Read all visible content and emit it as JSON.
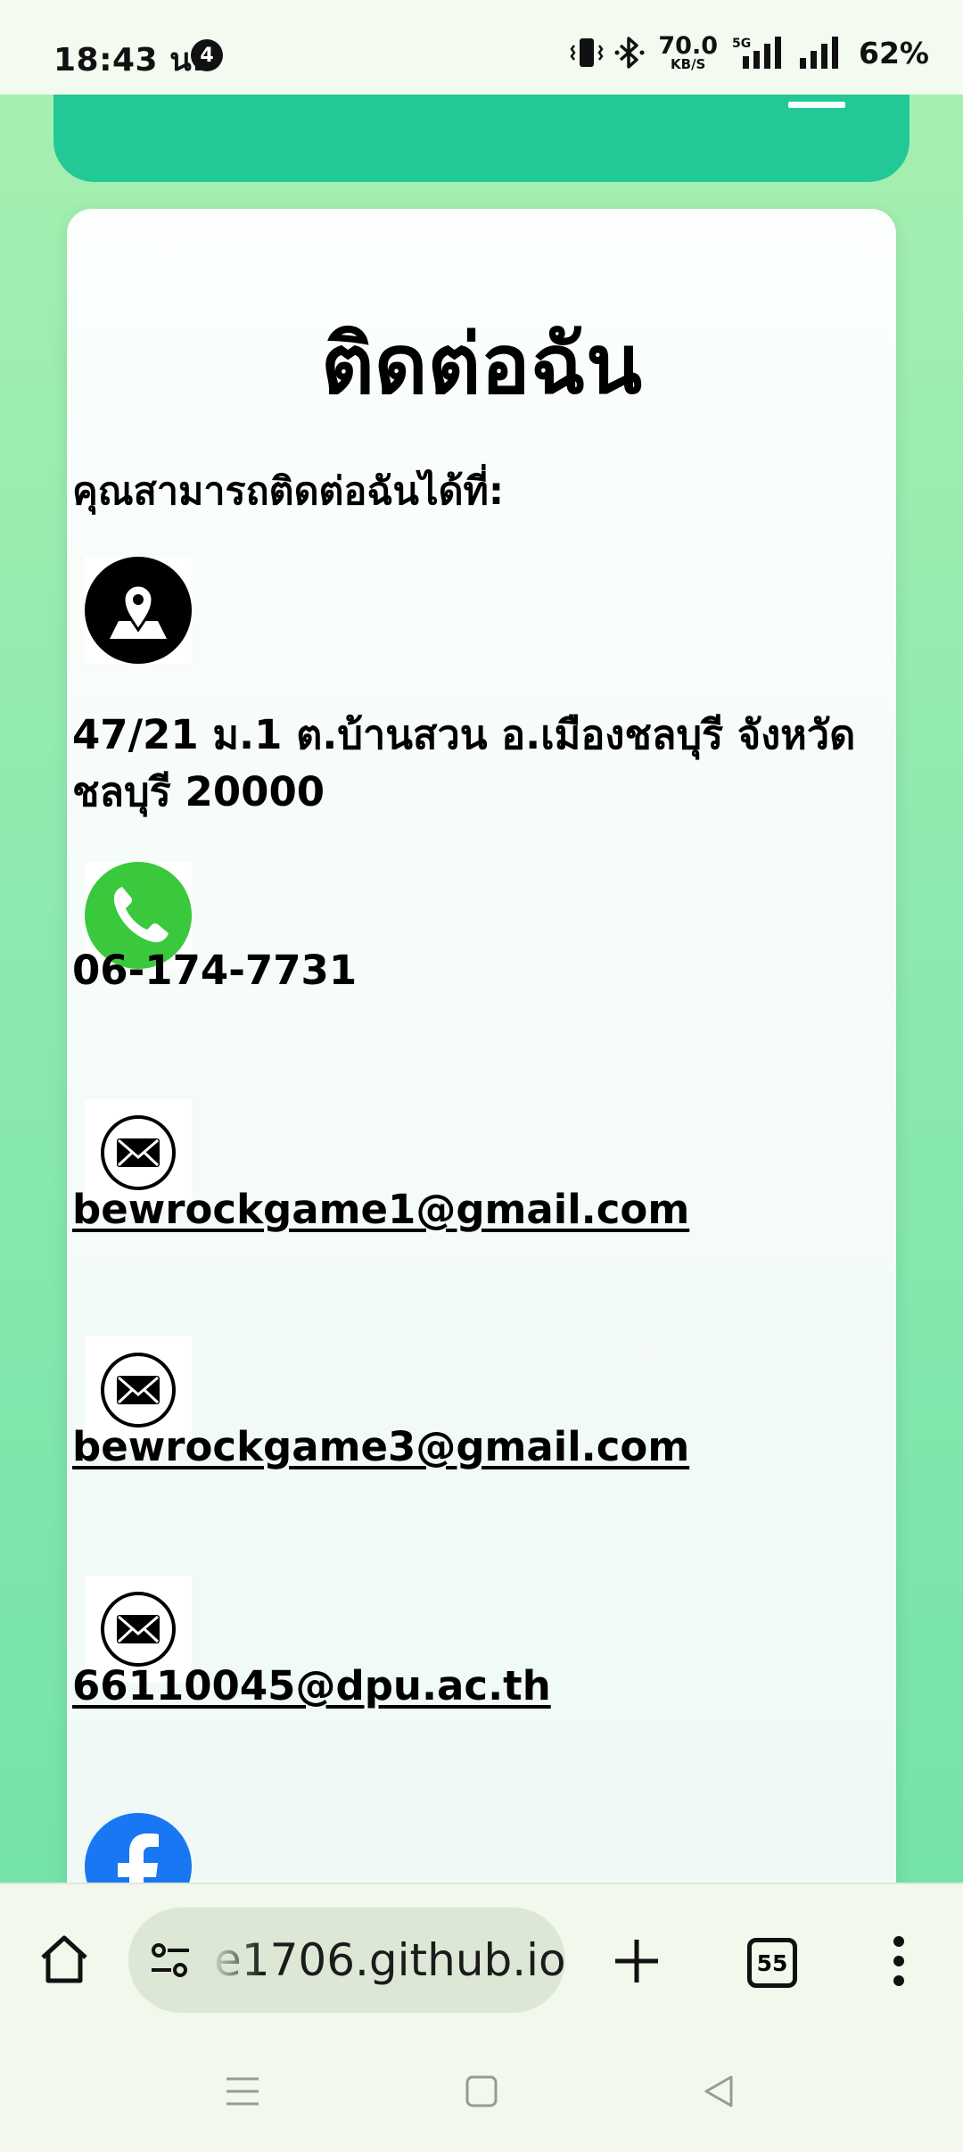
{
  "status_bar": {
    "time": "18:43 น.",
    "notification_count": "4",
    "network_speed_value": "70.0",
    "network_speed_unit": "KB/S",
    "network_type": "5G",
    "battery": "62%"
  },
  "contact": {
    "title": "ติดต่อฉัน",
    "subtitle": "คุณสามารถติดต่อฉันได้ที่:",
    "address": "47/21 ม.1 ต.บ้านสวน อ.เมืองชลบุรี จังหวัด ชลบุรี 20000",
    "phone": "06-174-7731",
    "email_1": "bewrockgame1@gmail.com",
    "email_2": "bewrockgame3@gmail.com",
    "email_3": "66110045@dpu.ac.th"
  },
  "icons": {
    "location": "map-pin-icon",
    "phone": "phone-icon",
    "email": "envelope-icon",
    "facebook": "facebook-icon"
  },
  "browser": {
    "url": "e1706.github.io",
    "tab_count": "55"
  },
  "colors": {
    "header": "#22c997",
    "phone_icon": "#3ac93c",
    "facebook_icon": "#1877f2"
  }
}
